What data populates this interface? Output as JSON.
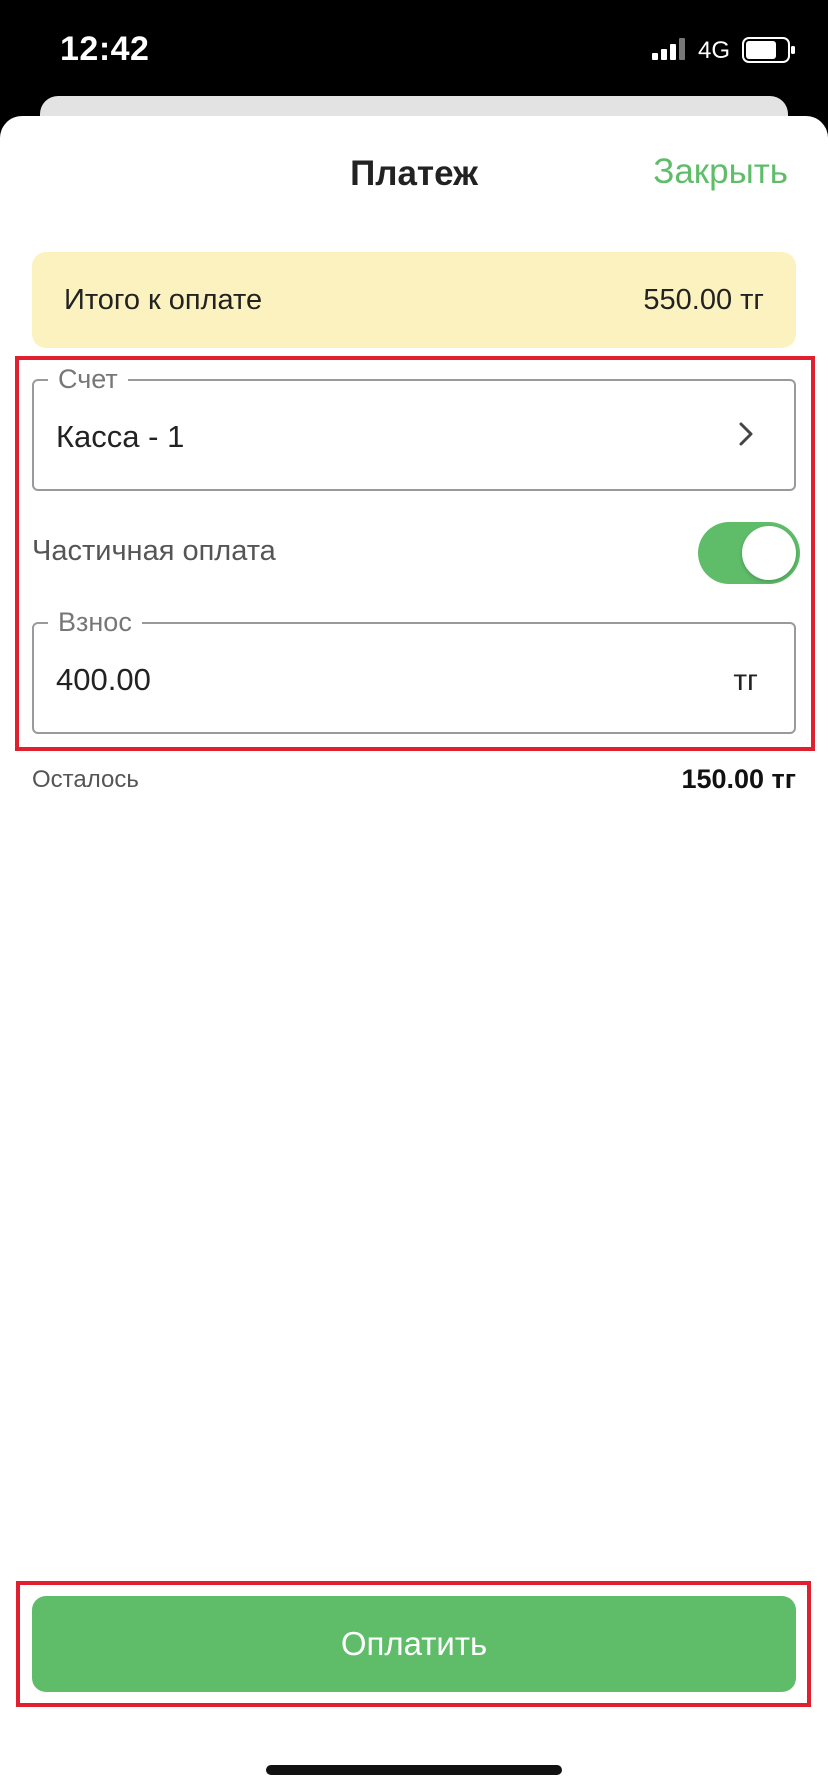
{
  "status_bar": {
    "time": "12:42",
    "network": "4G",
    "icons": [
      "signal-bars-icon",
      "battery-icon"
    ]
  },
  "header": {
    "title": "Платеж",
    "close_label": "Закрыть"
  },
  "total": {
    "label": "Итого к оплате",
    "value": "550.00 тг"
  },
  "account_field": {
    "legend": "Счет",
    "value": "Касса - 1",
    "icon": "chevron-right-icon"
  },
  "partial_payment": {
    "label": "Частичная оплата",
    "enabled": true
  },
  "deposit_field": {
    "legend": "Взнос",
    "value": "400.00",
    "unit": "тг"
  },
  "remaining": {
    "label": "Осталось",
    "value": "150.00 тг"
  },
  "pay_button": {
    "label": "Оплатить"
  },
  "colors": {
    "accent_green": "#5fbd6a",
    "total_card_bg": "#fcf2bf",
    "highlight_red": "#e0202f"
  }
}
